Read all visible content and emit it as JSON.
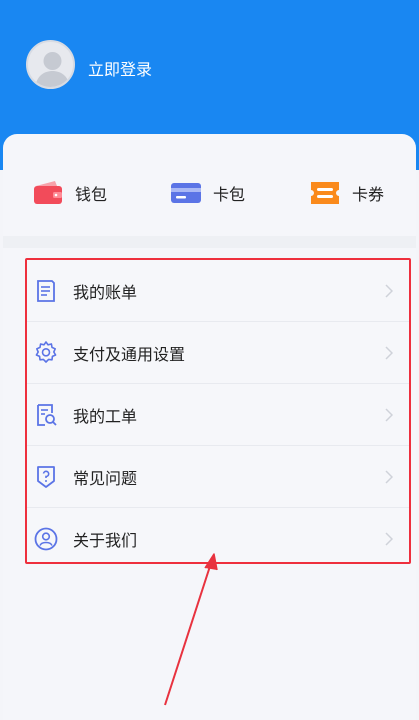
{
  "header": {
    "login_label": "立即登录",
    "bg_color": "#1987f2"
  },
  "quick_actions": [
    {
      "label": "钱包",
      "icon": "wallet-icon",
      "color": "#f24b5a"
    },
    {
      "label": "卡包",
      "icon": "card-icon",
      "color": "#5b74e6"
    },
    {
      "label": "卡券",
      "icon": "coupon-icon",
      "color": "#fa8a1c"
    }
  ],
  "menu": {
    "items": [
      {
        "label": "我的账单",
        "icon": "bill-icon"
      },
      {
        "label": "支付及通用设置",
        "icon": "settings-gear-icon"
      },
      {
        "label": "我的工单",
        "icon": "work-order-icon"
      },
      {
        "label": "常见问题",
        "icon": "faq-shield-icon"
      },
      {
        "label": "关于我们",
        "icon": "about-user-icon"
      }
    ],
    "highlight_color": "#ee2f3d"
  }
}
